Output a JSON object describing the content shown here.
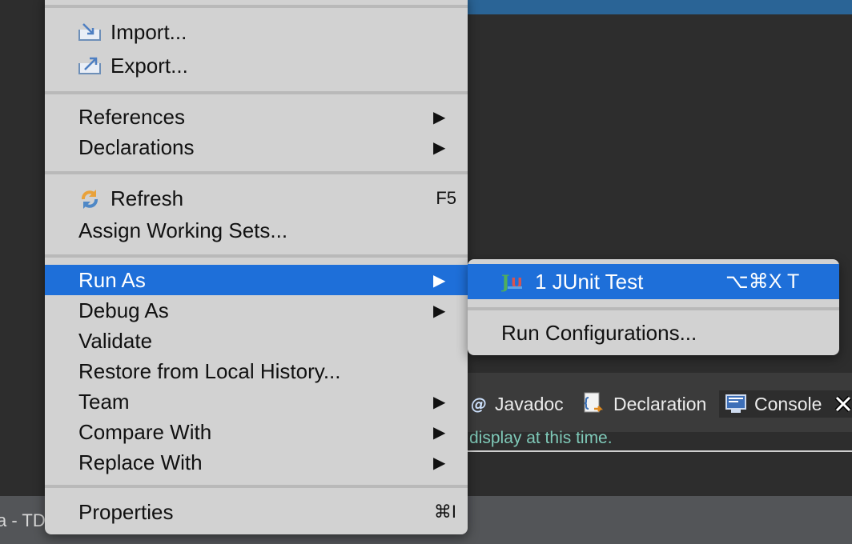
{
  "background": {
    "status_text": "a - TD",
    "tabs": [
      {
        "label": "Javadoc",
        "icon": "at-icon"
      },
      {
        "label": "Declaration",
        "icon": "declaration-icon"
      },
      {
        "label": "Console",
        "icon": "console-icon",
        "active": true
      }
    ],
    "console_message": "display at this time."
  },
  "context_menu": {
    "items": [
      {
        "label": "Import...",
        "icon": "import-icon"
      },
      {
        "label": "Export...",
        "icon": "export-icon"
      },
      {
        "label": "References",
        "submenu": true
      },
      {
        "label": "Declarations",
        "submenu": true
      },
      {
        "label": "Refresh",
        "icon": "refresh-icon",
        "shortcut": "F5"
      },
      {
        "label": "Assign Working Sets..."
      },
      {
        "label": "Run As",
        "submenu": true,
        "highlighted": true
      },
      {
        "label": "Debug As",
        "submenu": true
      },
      {
        "label": "Validate"
      },
      {
        "label": "Restore from Local History..."
      },
      {
        "label": "Team",
        "submenu": true
      },
      {
        "label": "Compare With",
        "submenu": true
      },
      {
        "label": "Replace With",
        "submenu": true
      },
      {
        "label": "Properties",
        "shortcut": "⌘I"
      }
    ],
    "submenu_arrow": "▶"
  },
  "run_as_submenu": {
    "items": [
      {
        "label": "1 JUnit Test",
        "icon": "junit-icon",
        "shortcut": "⌥⌘X T",
        "highlighted": true
      },
      {
        "label": "Run Configurations..."
      }
    ]
  },
  "colors": {
    "highlight": "#1e6fd9",
    "menu_bg": "#d2d2d2",
    "console_text": "#7fc9b8"
  }
}
